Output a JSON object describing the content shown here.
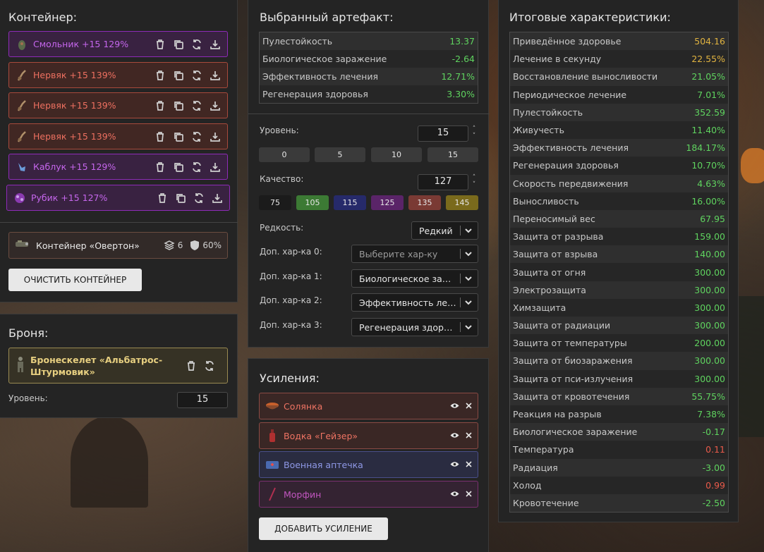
{
  "container": {
    "title": "Контейнер:",
    "artifacts": [
      {
        "name": "Смольник +15 129%",
        "tone": "purple",
        "icon": "resin-artifact-icon"
      },
      {
        "name": "Нервяк +15 139%",
        "tone": "red",
        "icon": "nerve-artifact-icon"
      },
      {
        "name": "Нервяк +15 139%",
        "tone": "red",
        "icon": "nerve-artifact-icon"
      },
      {
        "name": "Нервяк +15 139%",
        "tone": "red",
        "icon": "nerve-artifact-icon"
      },
      {
        "name": "Каблук +15 129%",
        "tone": "purple",
        "icon": "heel-artifact-icon"
      },
      {
        "name": "Рубик +15 127%",
        "tone": "purple",
        "icon": "rubik-artifact-icon"
      }
    ],
    "container_item": {
      "name": "Контейнер «Овертон»",
      "slots": "6",
      "protection": "60%"
    },
    "clear_label": "Очистить контейнер"
  },
  "armor": {
    "title": "Броня:",
    "name": "Бронескелет «Альбатрос-Штурмовик»",
    "level_label": "Уровень:",
    "level_value": "15"
  },
  "artifact": {
    "title": "Выбранный артефакт:",
    "stats": [
      {
        "label": "Пулестойкость",
        "value": "13.37",
        "color": "#5fd35f"
      },
      {
        "label": "Биологическое заражение",
        "value": "-2.64",
        "color": "#5fd35f"
      },
      {
        "label": "Эффективность лечения",
        "value": "12.71%",
        "color": "#5fd35f"
      },
      {
        "label": "Регенерация здоровья",
        "value": "3.30%",
        "color": "#5fd35f"
      }
    ],
    "level_label": "Уровень:",
    "level_value": "15",
    "level_presets": [
      "0",
      "5",
      "10",
      "15"
    ],
    "quality_label": "Качество:",
    "quality_value": "127",
    "quality_presets": [
      {
        "label": "75",
        "color": "#1b1b1b"
      },
      {
        "label": "105",
        "color": "#3c7a34"
      },
      {
        "label": "115",
        "color": "#262a6a"
      },
      {
        "label": "125",
        "color": "#5a2468"
      },
      {
        "label": "135",
        "color": "#7a3a34"
      },
      {
        "label": "145",
        "color": "#7a6a1c"
      }
    ],
    "rarity_label": "Редкость:",
    "rarity_value": "Редкий",
    "extra": [
      {
        "label": "Доп. хар-ка 0:",
        "value": "Выберите хар-ку",
        "placeholder": true
      },
      {
        "label": "Доп. хар-ка 1:",
        "value": "Биологическое заражение",
        "placeholder": false
      },
      {
        "label": "Доп. хар-ка 2:",
        "value": "Эффективность лечения",
        "placeholder": false
      },
      {
        "label": "Доп. хар-ка 3:",
        "value": "Регенерация здоровья",
        "placeholder": false
      }
    ]
  },
  "boosts": {
    "title": "Усиления:",
    "items": [
      {
        "name": "Солянка",
        "tone": "red",
        "icon": "soup-icon"
      },
      {
        "name": "Водка «Гейзер»",
        "tone": "red",
        "icon": "bottle-icon"
      },
      {
        "name": "Военная аптечка",
        "tone": "blue",
        "icon": "medkit-icon"
      },
      {
        "name": "Морфин",
        "tone": "purple",
        "icon": "syringe-icon"
      }
    ],
    "add_label": "Добавить усиление"
  },
  "totals": {
    "title": "Итоговые характеристики:",
    "rows": [
      {
        "label": "Приведённое здоровье",
        "value": "504.16",
        "color": "#e0b340"
      },
      {
        "label": "Лечение в секунду",
        "value": "22.55%",
        "color": "#e0b340"
      },
      {
        "label": "Восстановление выносливости",
        "value": "21.05%",
        "color": "#5fd35f"
      },
      {
        "label": "Периодическое лечение",
        "value": "7.01%",
        "color": "#5fd35f"
      },
      {
        "label": "Пулестойкость",
        "value": "352.59",
        "color": "#5fd35f"
      },
      {
        "label": "Живучесть",
        "value": "11.40%",
        "color": "#5fd35f"
      },
      {
        "label": "Эффективность лечения",
        "value": "184.17%",
        "color": "#5fd35f"
      },
      {
        "label": "Регенерация здоровья",
        "value": "10.70%",
        "color": "#5fd35f"
      },
      {
        "label": "Скорость передвижения",
        "value": "4.63%",
        "color": "#5fd35f"
      },
      {
        "label": "Выносливость",
        "value": "16.00%",
        "color": "#5fd35f"
      },
      {
        "label": "Переносимый вес",
        "value": "67.95",
        "color": "#5fd35f"
      },
      {
        "label": "Защита от разрыва",
        "value": "159.00",
        "color": "#5fd35f"
      },
      {
        "label": "Защита от взрыва",
        "value": "140.00",
        "color": "#5fd35f"
      },
      {
        "label": "Защита от огня",
        "value": "300.00",
        "color": "#5fd35f"
      },
      {
        "label": "Электрозащита",
        "value": "300.00",
        "color": "#5fd35f"
      },
      {
        "label": "Химзащита",
        "value": "300.00",
        "color": "#5fd35f"
      },
      {
        "label": "Защита от радиации",
        "value": "300.00",
        "color": "#5fd35f"
      },
      {
        "label": "Защита от температуры",
        "value": "200.00",
        "color": "#5fd35f"
      },
      {
        "label": "Защита от биозаражения",
        "value": "300.00",
        "color": "#5fd35f"
      },
      {
        "label": "Защита от пси-излучения",
        "value": "300.00",
        "color": "#5fd35f"
      },
      {
        "label": "Защита от кровотечения",
        "value": "55.75%",
        "color": "#5fd35f"
      },
      {
        "label": "Реакция на разрыв",
        "value": "7.38%",
        "color": "#5fd35f"
      },
      {
        "label": "Биологическое заражение",
        "value": "-0.17",
        "color": "#5fd35f"
      },
      {
        "label": "Температура",
        "value": "0.11",
        "color": "#e85a4a"
      },
      {
        "label": "Радиация",
        "value": "-3.00",
        "color": "#5fd35f"
      },
      {
        "label": "Холод",
        "value": "0.99",
        "color": "#e85a4a"
      },
      {
        "label": "Кровотечение",
        "value": "-2.50",
        "color": "#5fd35f"
      }
    ]
  }
}
